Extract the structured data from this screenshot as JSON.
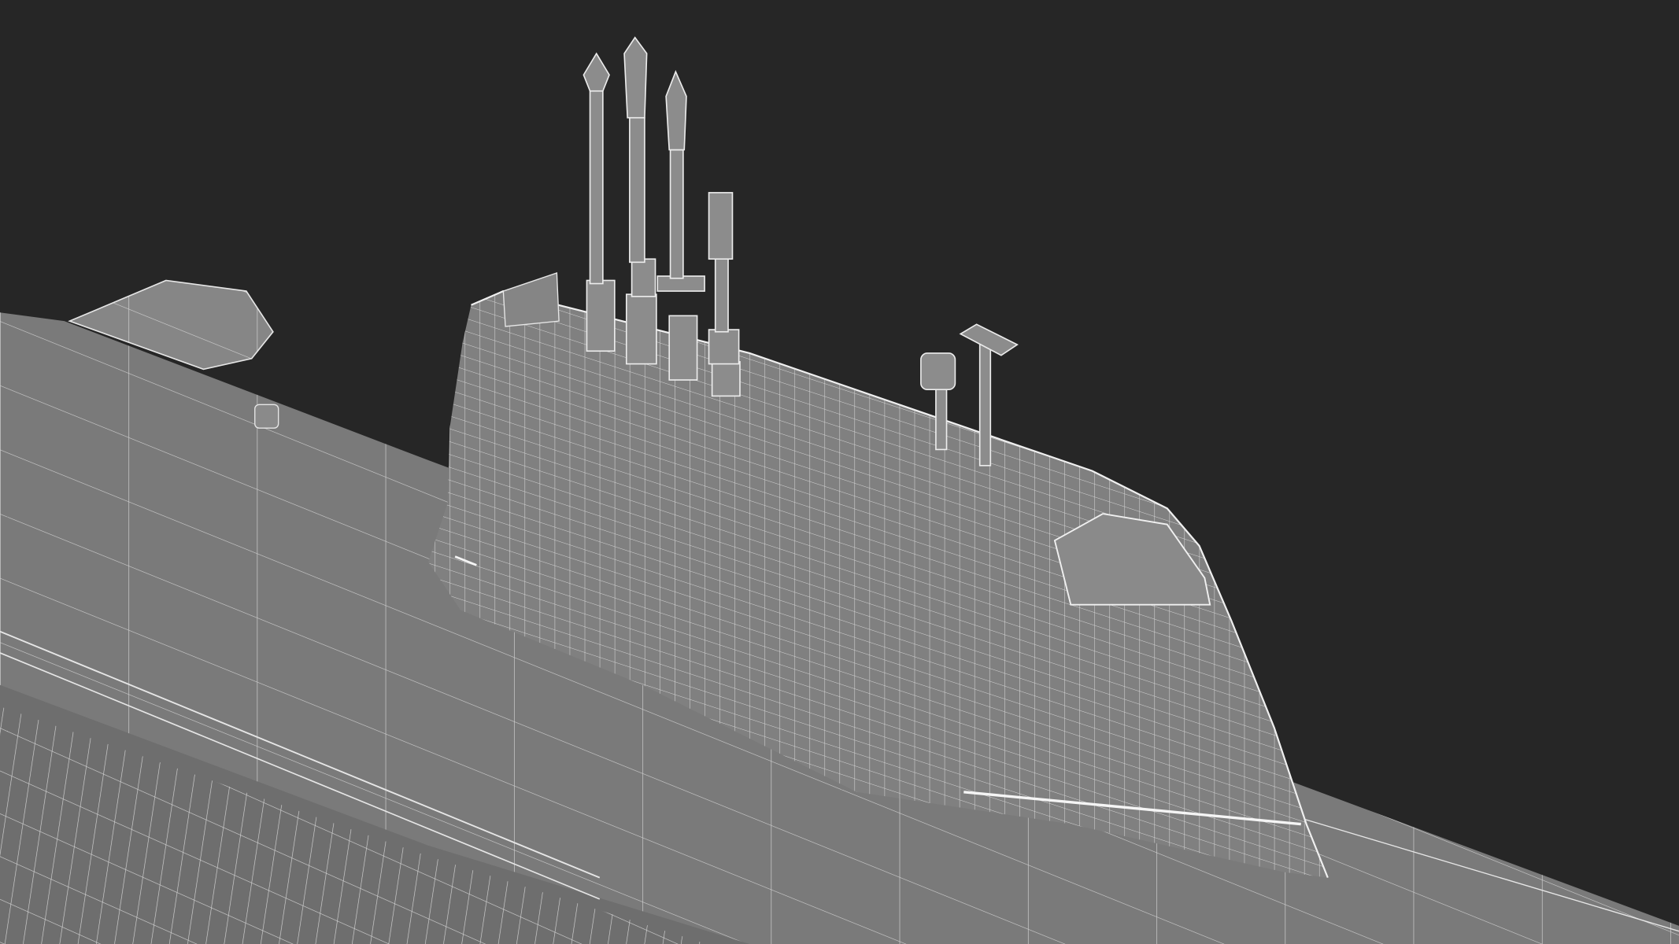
{
  "scene": {
    "subject": "submarine-wireframe-render",
    "colors": {
      "background": "#262626",
      "hull": "#7a7a7a",
      "hull_shadow": "#6a6a6a",
      "sail": "#808080",
      "wire": "#e6e6e6"
    }
  }
}
